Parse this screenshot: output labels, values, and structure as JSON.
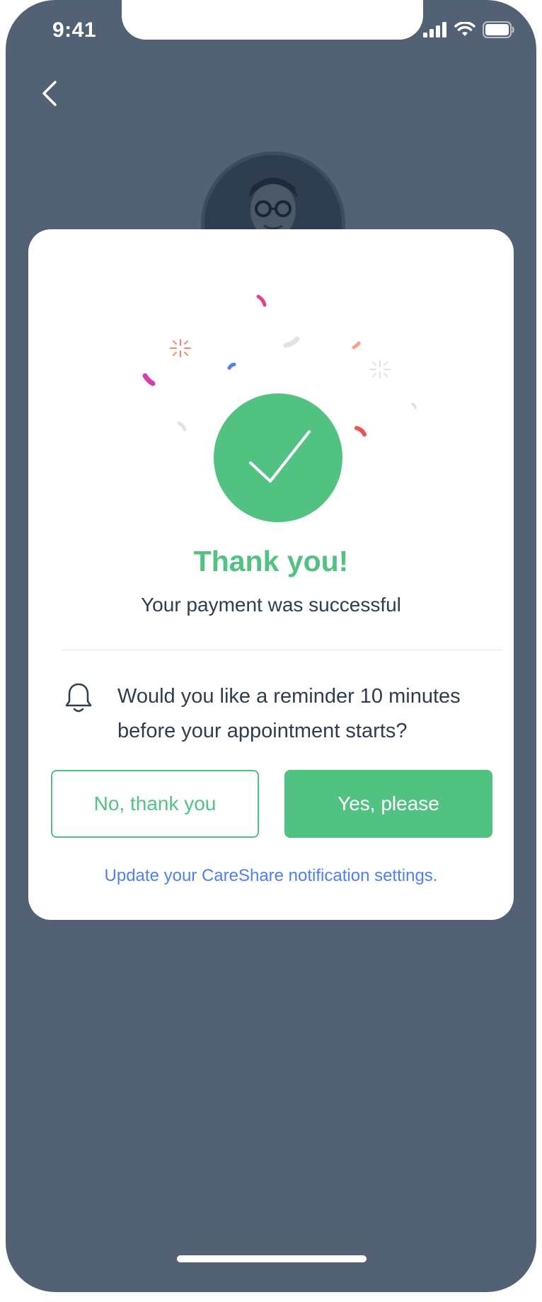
{
  "status_bar": {
    "time": "9:41"
  },
  "header": {
    "back_icon": "chevron-left-icon"
  },
  "modal": {
    "title": "Thank you!",
    "subtitle": "Your payment was successful",
    "reminder_icon": "bell-icon",
    "question": "Would you like a reminder 10 minutes before your appointment starts?",
    "no_button_label": "No, thank you",
    "yes_button_label": "Yes, please",
    "settings_link": "Update your CareShare notification settings."
  },
  "colors": {
    "background": "#526274",
    "accent_green": "#52c283",
    "link_blue": "#4f7ff0",
    "text_dark": "#2f3e4f"
  }
}
